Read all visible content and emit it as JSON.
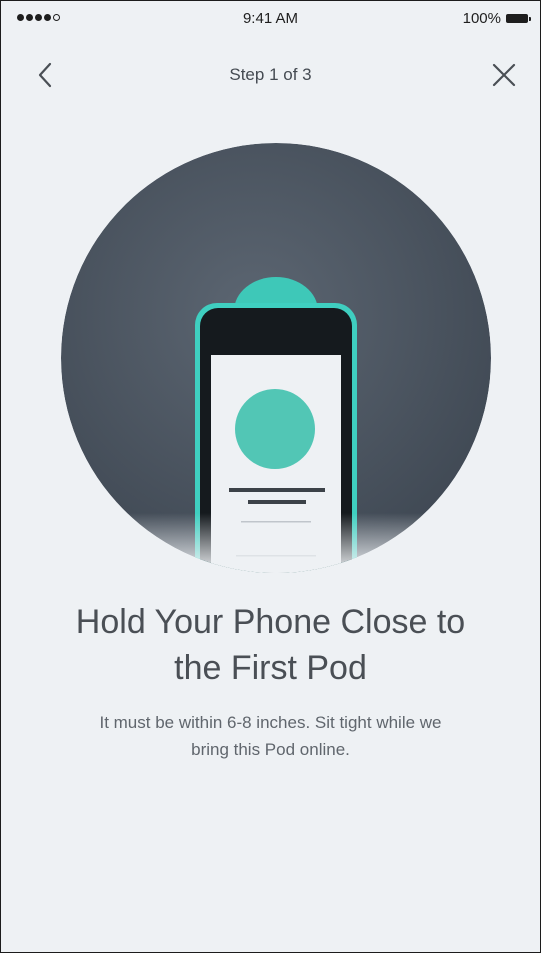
{
  "status_bar": {
    "signal_icon": "signal-dots-icon",
    "time": "9:41 AM",
    "battery_percent": "100%",
    "battery_icon": "battery-full-icon"
  },
  "nav": {
    "back_icon": "chevron-left-icon",
    "title": "Step 1 of 3",
    "close_icon": "close-icon"
  },
  "illustration": {
    "name": "phone-near-pod-illustration",
    "colors": {
      "backdrop": "#4b5460",
      "accent_teal": "#3ec8b8",
      "phone_screen": "#eef1f4"
    }
  },
  "content": {
    "headline_line1": "Hold Your Phone Close to",
    "headline_line2": "the First Pod",
    "body_line1": "It must be within 6-8 inches. Sit tight while we",
    "body_line2": "bring this Pod online."
  }
}
